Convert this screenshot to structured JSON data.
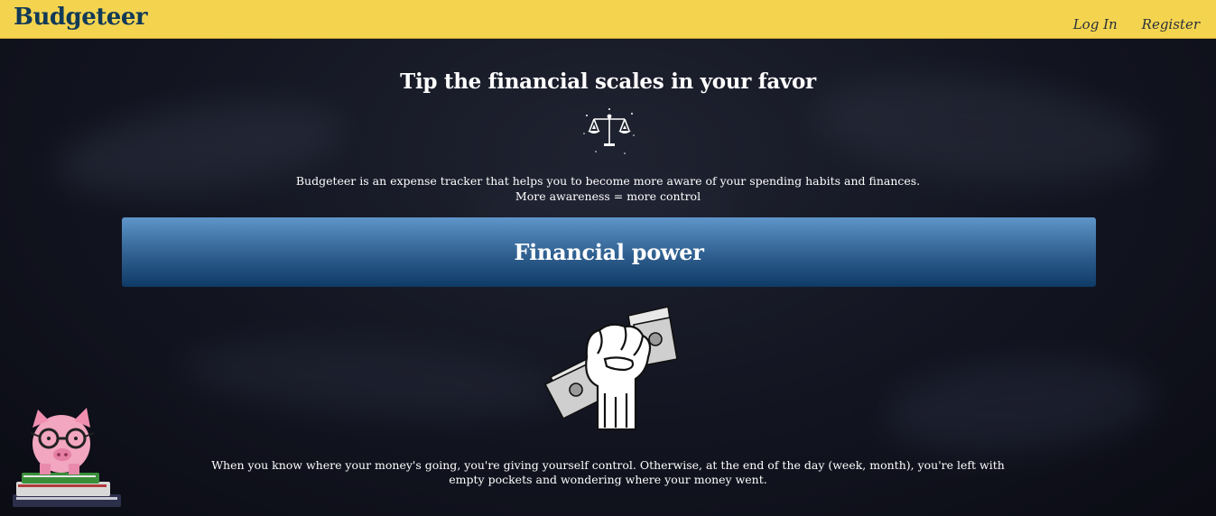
{
  "navbar": {
    "brand": "Budgeteer",
    "login_label": "Log In",
    "register_label": "Register",
    "background_color": "#f4d44f",
    "brand_color": "#123a57"
  },
  "hero": {
    "headline": "Tip the financial scales in your favor",
    "icon": "balance-scale-icon",
    "intro_line1": "Budgeteer is an expense tracker that helps you to become more aware of your spending habits and finances.",
    "intro_line2": "More awareness = more control"
  },
  "section": {
    "banner_title": "Financial power",
    "banner_color_top": "#5e95c9",
    "banner_color_bottom": "#0e3a66",
    "illustration": "fist-holding-money-icon",
    "body_line1": "When you know where your money's going, you're giving yourself control. Otherwise, at the end of the day (week, month), you're left with",
    "body_line2": "empty pockets and wondering where your money went."
  },
  "decoration": {
    "illustration": "piggy-bank-on-books-icon"
  }
}
